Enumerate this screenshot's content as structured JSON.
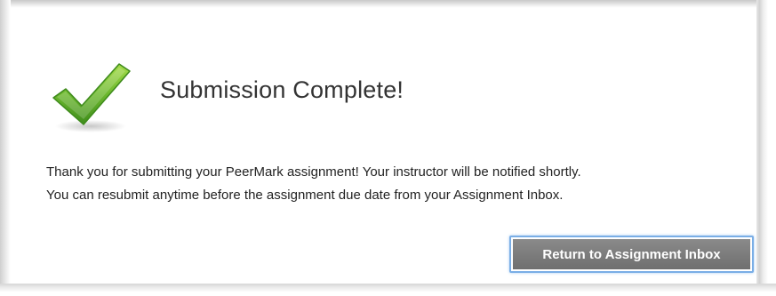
{
  "dialog": {
    "icon": "checkmark-icon",
    "accent_color": "#6cb82e",
    "title": "Submission Complete!",
    "message_lines": [
      "Thank you for submitting your PeerMark assignment! Your instructor will be notified shortly.",
      "You can resubmit anytime before the assignment due date from your Assignment Inbox."
    ],
    "button_label": "Return to Assignment Inbox",
    "button_color": "#787878",
    "focus_ring_color": "#7aaee6"
  }
}
